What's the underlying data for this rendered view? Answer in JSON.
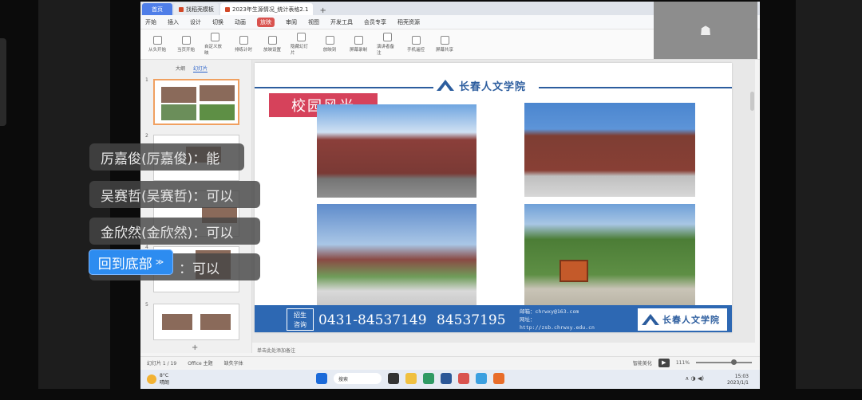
{
  "browser_tabs": [
    {
      "label": "首页"
    },
    {
      "label": "找稻壳模板"
    },
    {
      "label": "2023年生源情况_统计表格2.1"
    }
  ],
  "menu": [
    "开始",
    "插入",
    "设计",
    "切换",
    "动画",
    "放映",
    "审阅",
    "视图",
    "开发工具",
    "会员专享",
    "稻壳资源"
  ],
  "menu_selected_index": 5,
  "ribbon_buttons": [
    "从头开始",
    "当页开始",
    "自定义放映",
    "排练计时",
    "放映设置",
    "隐藏幻灯片",
    "放映到",
    "屏幕录制",
    "演讲者备注",
    "手机遥控",
    "屏幕共享"
  ],
  "thumb_pane": {
    "tabs": [
      "大纲",
      "幻灯片"
    ],
    "selected": 1,
    "numbers": [
      "1",
      "2",
      "3",
      "4",
      "5"
    ],
    "add": "+"
  },
  "slide": {
    "school_name": "长春人文学院",
    "section_title": "校园风光",
    "consult": "招生\n咨询",
    "phone1": "0431-84537149",
    "phone2": "84537195",
    "info": [
      "邮箱：chrwxy@163.com",
      "网址：",
      "http://zsb.chrwxy.edu.cn"
    ],
    "footer_logo": "长春人文学院"
  },
  "notes_hint": "单击此处添加备注",
  "status": {
    "slide": "幻灯片 1 / 19",
    "theme": "Office 主题",
    "missing": "缺失字体",
    "notes": "智能美化",
    "zoom": "111%"
  },
  "taskbar": {
    "weather_temp": "8°C",
    "weather_desc": "晴朗",
    "search": "搜索",
    "time": "15:03",
    "date": "2023/1/1"
  },
  "chat": [
    {
      "text": "厉嘉俊(厉嘉俊)：能"
    },
    {
      "text": "吴赛哲(吴赛哲)：可以"
    },
    {
      "text": "金欣然(金欣然)：可以"
    },
    {
      "text": "：可以"
    }
  ],
  "back_button": "回到底部",
  "camera_icon": "user-silhouette-icon",
  "colors": {
    "section_title": "#d6425b",
    "footer": "#2d68b3",
    "accent": "#2d8cf0"
  }
}
